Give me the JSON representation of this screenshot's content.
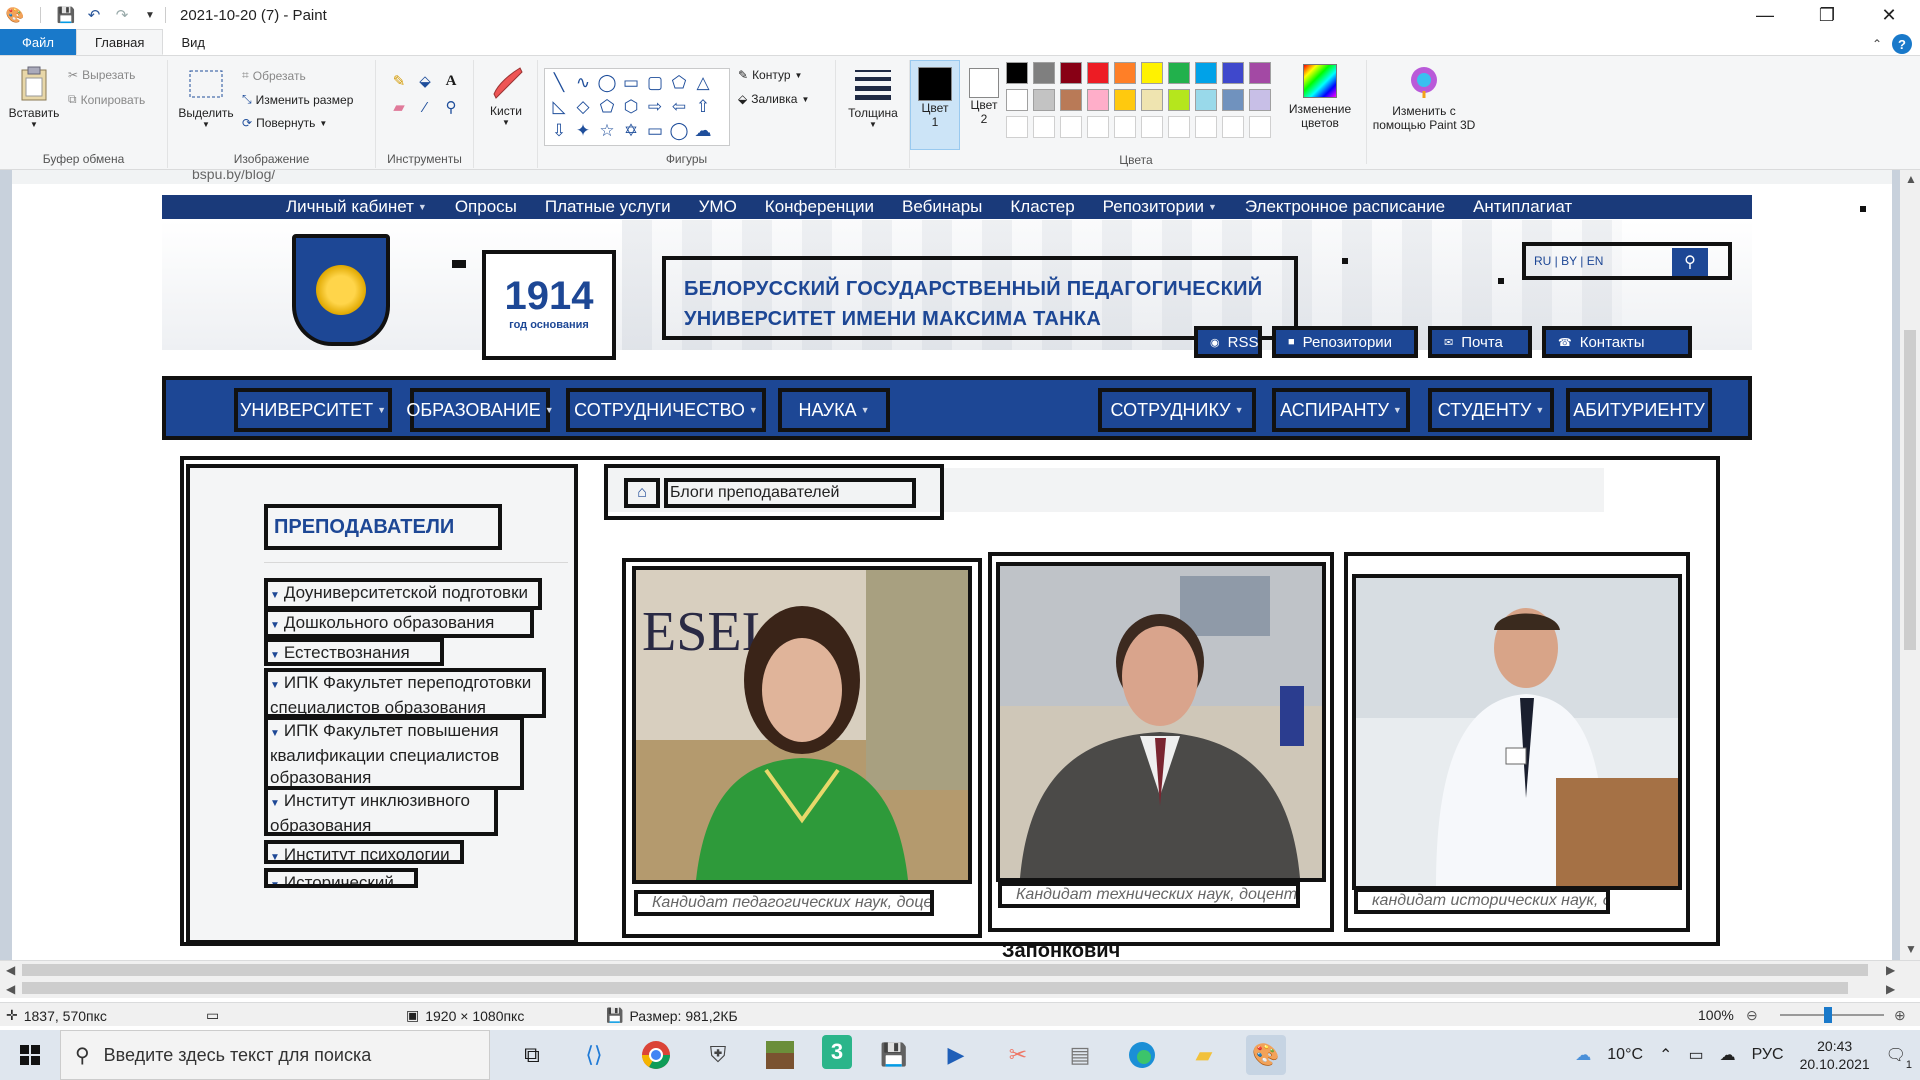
{
  "window": {
    "title": "2021-10-20 (7) - Paint"
  },
  "ribbon_tabs": [
    "Файл",
    "Главная",
    "Вид"
  ],
  "ribbon": {
    "clipboard": {
      "paste": "Вставить",
      "cut": "Вырезать",
      "copy": "Копировать",
      "label": "Буфер обмена"
    },
    "image": {
      "select": "Выделить",
      "crop": "Обрезать",
      "resize": "Изменить размер",
      "rotate": "Повернуть",
      "label": "Изображение"
    },
    "tools": {
      "label": "Инструменты"
    },
    "brushes": {
      "label": "Кисти"
    },
    "shapes": {
      "outline": "Контур",
      "fill": "Заливка",
      "label": "Фигуры"
    },
    "size": {
      "label": "Толщина"
    },
    "color1": {
      "label1": "Цвет",
      "label2": "1",
      "value": "#000000"
    },
    "color2": {
      "label1": "Цвет",
      "label2": "2",
      "value": "#ffffff"
    },
    "colors": {
      "label": "Цвета",
      "row1": [
        "#000000",
        "#7f7f7f",
        "#880015",
        "#ed1c24",
        "#ff7f27",
        "#fff200",
        "#22b14c",
        "#00a2e8",
        "#3f48cc",
        "#a349a4"
      ],
      "row2": [
        "#ffffff",
        "#c3c3c3",
        "#b97a57",
        "#ffaec9",
        "#ffc90e",
        "#efe4b0",
        "#b5e61d",
        "#99d9ea",
        "#7092be",
        "#c8bfe7"
      ],
      "row3": [
        "#ffffff",
        "#ffffff",
        "#ffffff",
        "#ffffff",
        "#ffffff",
        "#ffffff",
        "#ffffff",
        "#ffffff",
        "#ffffff",
        "#ffffff"
      ]
    },
    "edit_colors": {
      "line1": "Изменение",
      "line2": "цветов"
    },
    "paint3d": {
      "line1": "Изменить с",
      "line2": "помощью Paint 3D"
    }
  },
  "canvas": {
    "url": "bspu.by/blog/",
    "topbar": [
      {
        "label": "Личный кабинет",
        "caret": true
      },
      {
        "label": "Опросы",
        "caret": false
      },
      {
        "label": "Платные услуги",
        "caret": false
      },
      {
        "label": "УМО",
        "caret": false
      },
      {
        "label": "Конференции",
        "caret": false
      },
      {
        "label": "Вебинары",
        "caret": false
      },
      {
        "label": "Кластер",
        "caret": false
      },
      {
        "label": "Репозитории",
        "caret": true
      },
      {
        "label": "Электронное расписание",
        "caret": false
      },
      {
        "label": "Антиплагиат",
        "caret": false
      }
    ],
    "year": "1914",
    "year_caption": "год основания",
    "university_line1": "БЕЛОРУССКИЙ ГОСУДАРСТВЕННЫЙ ПЕДАГОГИЧЕСКИЙ",
    "university_line2": "УНИВЕРСИТЕТ ИМЕНИ МАКСИМА ТАНКА",
    "langs": "RU | BY | EN",
    "header_links": [
      "RSS",
      "Репозитории",
      "Почта",
      "Контакты"
    ],
    "main_nav": [
      "УНИВЕРСИТЕТ",
      "ОБРАЗОВАНИЕ",
      "СОТРУДНИЧЕСТВО",
      "НАУКА",
      "СОТРУДНИКУ",
      "АСПИРАНТУ",
      "СТУДЕНТУ",
      "АБИТУРИЕНТУ"
    ],
    "sidebar_title": "ПРЕПОДАВАТЕЛИ",
    "sidebar_items": [
      "Доуниверситетской подготовки",
      "Дошкольного образования",
      "Естествознания",
      "ИПК Факультет переподготовки специалистов образования",
      "ИПК Факультет повышения квалификации специалистов образования",
      "Институт инклюзивного образования",
      "Институт психологии",
      "Исторический"
    ],
    "breadcrumb": "Блоги преподавателей",
    "cards": [
      {
        "caption": "Кандидат педагогических наук, доцент"
      },
      {
        "caption": "Кандидат технических наук, доцент"
      },
      {
        "caption": "кандидат исторических наук, доцент"
      }
    ],
    "below_text": "Запонкович"
  },
  "status": {
    "cursor": "1837, 570пкс",
    "dimensions": "1920 × 1080пкс",
    "size": "Размер: 981,2КБ",
    "zoom": "100%"
  },
  "taskbar": {
    "search_placeholder": "Введите здесь текст для поиска",
    "temperature": "10°C",
    "language": "РУС",
    "time": "20:43",
    "date": "20.10.2021",
    "notifications": "1"
  }
}
